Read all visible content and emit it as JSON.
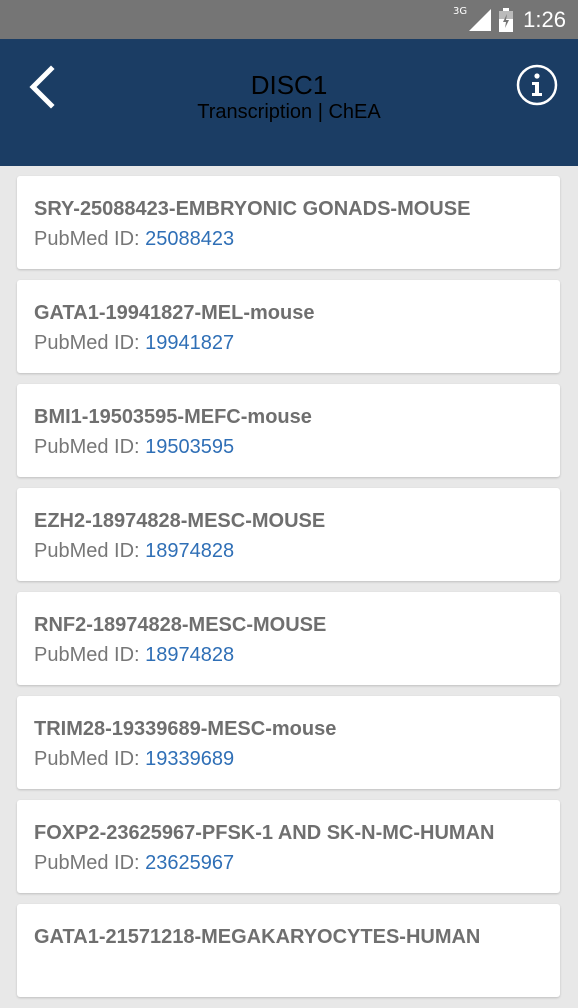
{
  "status_bar": {
    "network": "3G",
    "time": "1:26"
  },
  "header": {
    "title": "DISC1",
    "subtitle": "Transcription | ChEA"
  },
  "pubmed_label": "PubMed ID: ",
  "items": [
    {
      "title": "SRY-25088423-EMBRYONIC GONADS-MOUSE",
      "pubmed_id": "25088423"
    },
    {
      "title": "GATA1-19941827-MEL-mouse",
      "pubmed_id": "19941827"
    },
    {
      "title": "BMI1-19503595-MEFC-mouse",
      "pubmed_id": "19503595"
    },
    {
      "title": "EZH2-18974828-MESC-MOUSE",
      "pubmed_id": "18974828"
    },
    {
      "title": "RNF2-18974828-MESC-MOUSE",
      "pubmed_id": "18974828"
    },
    {
      "title": "TRIM28-19339689-MESC-mouse",
      "pubmed_id": "19339689"
    },
    {
      "title": "FOXP2-23625967-PFSK-1 AND SK-N-MC-HUMAN",
      "pubmed_id": "23625967"
    },
    {
      "title": "GATA1-21571218-MEGAKARYOCYTES-HUMAN",
      "pubmed_id": ""
    }
  ],
  "colors": {
    "app_bar": "#1b3d64",
    "status_bar": "#757575",
    "link": "#2f6fb6"
  },
  "icons": {
    "back": "back-arrow-icon",
    "info": "info-icon",
    "signal": "signal-icon",
    "battery": "battery-icon"
  }
}
